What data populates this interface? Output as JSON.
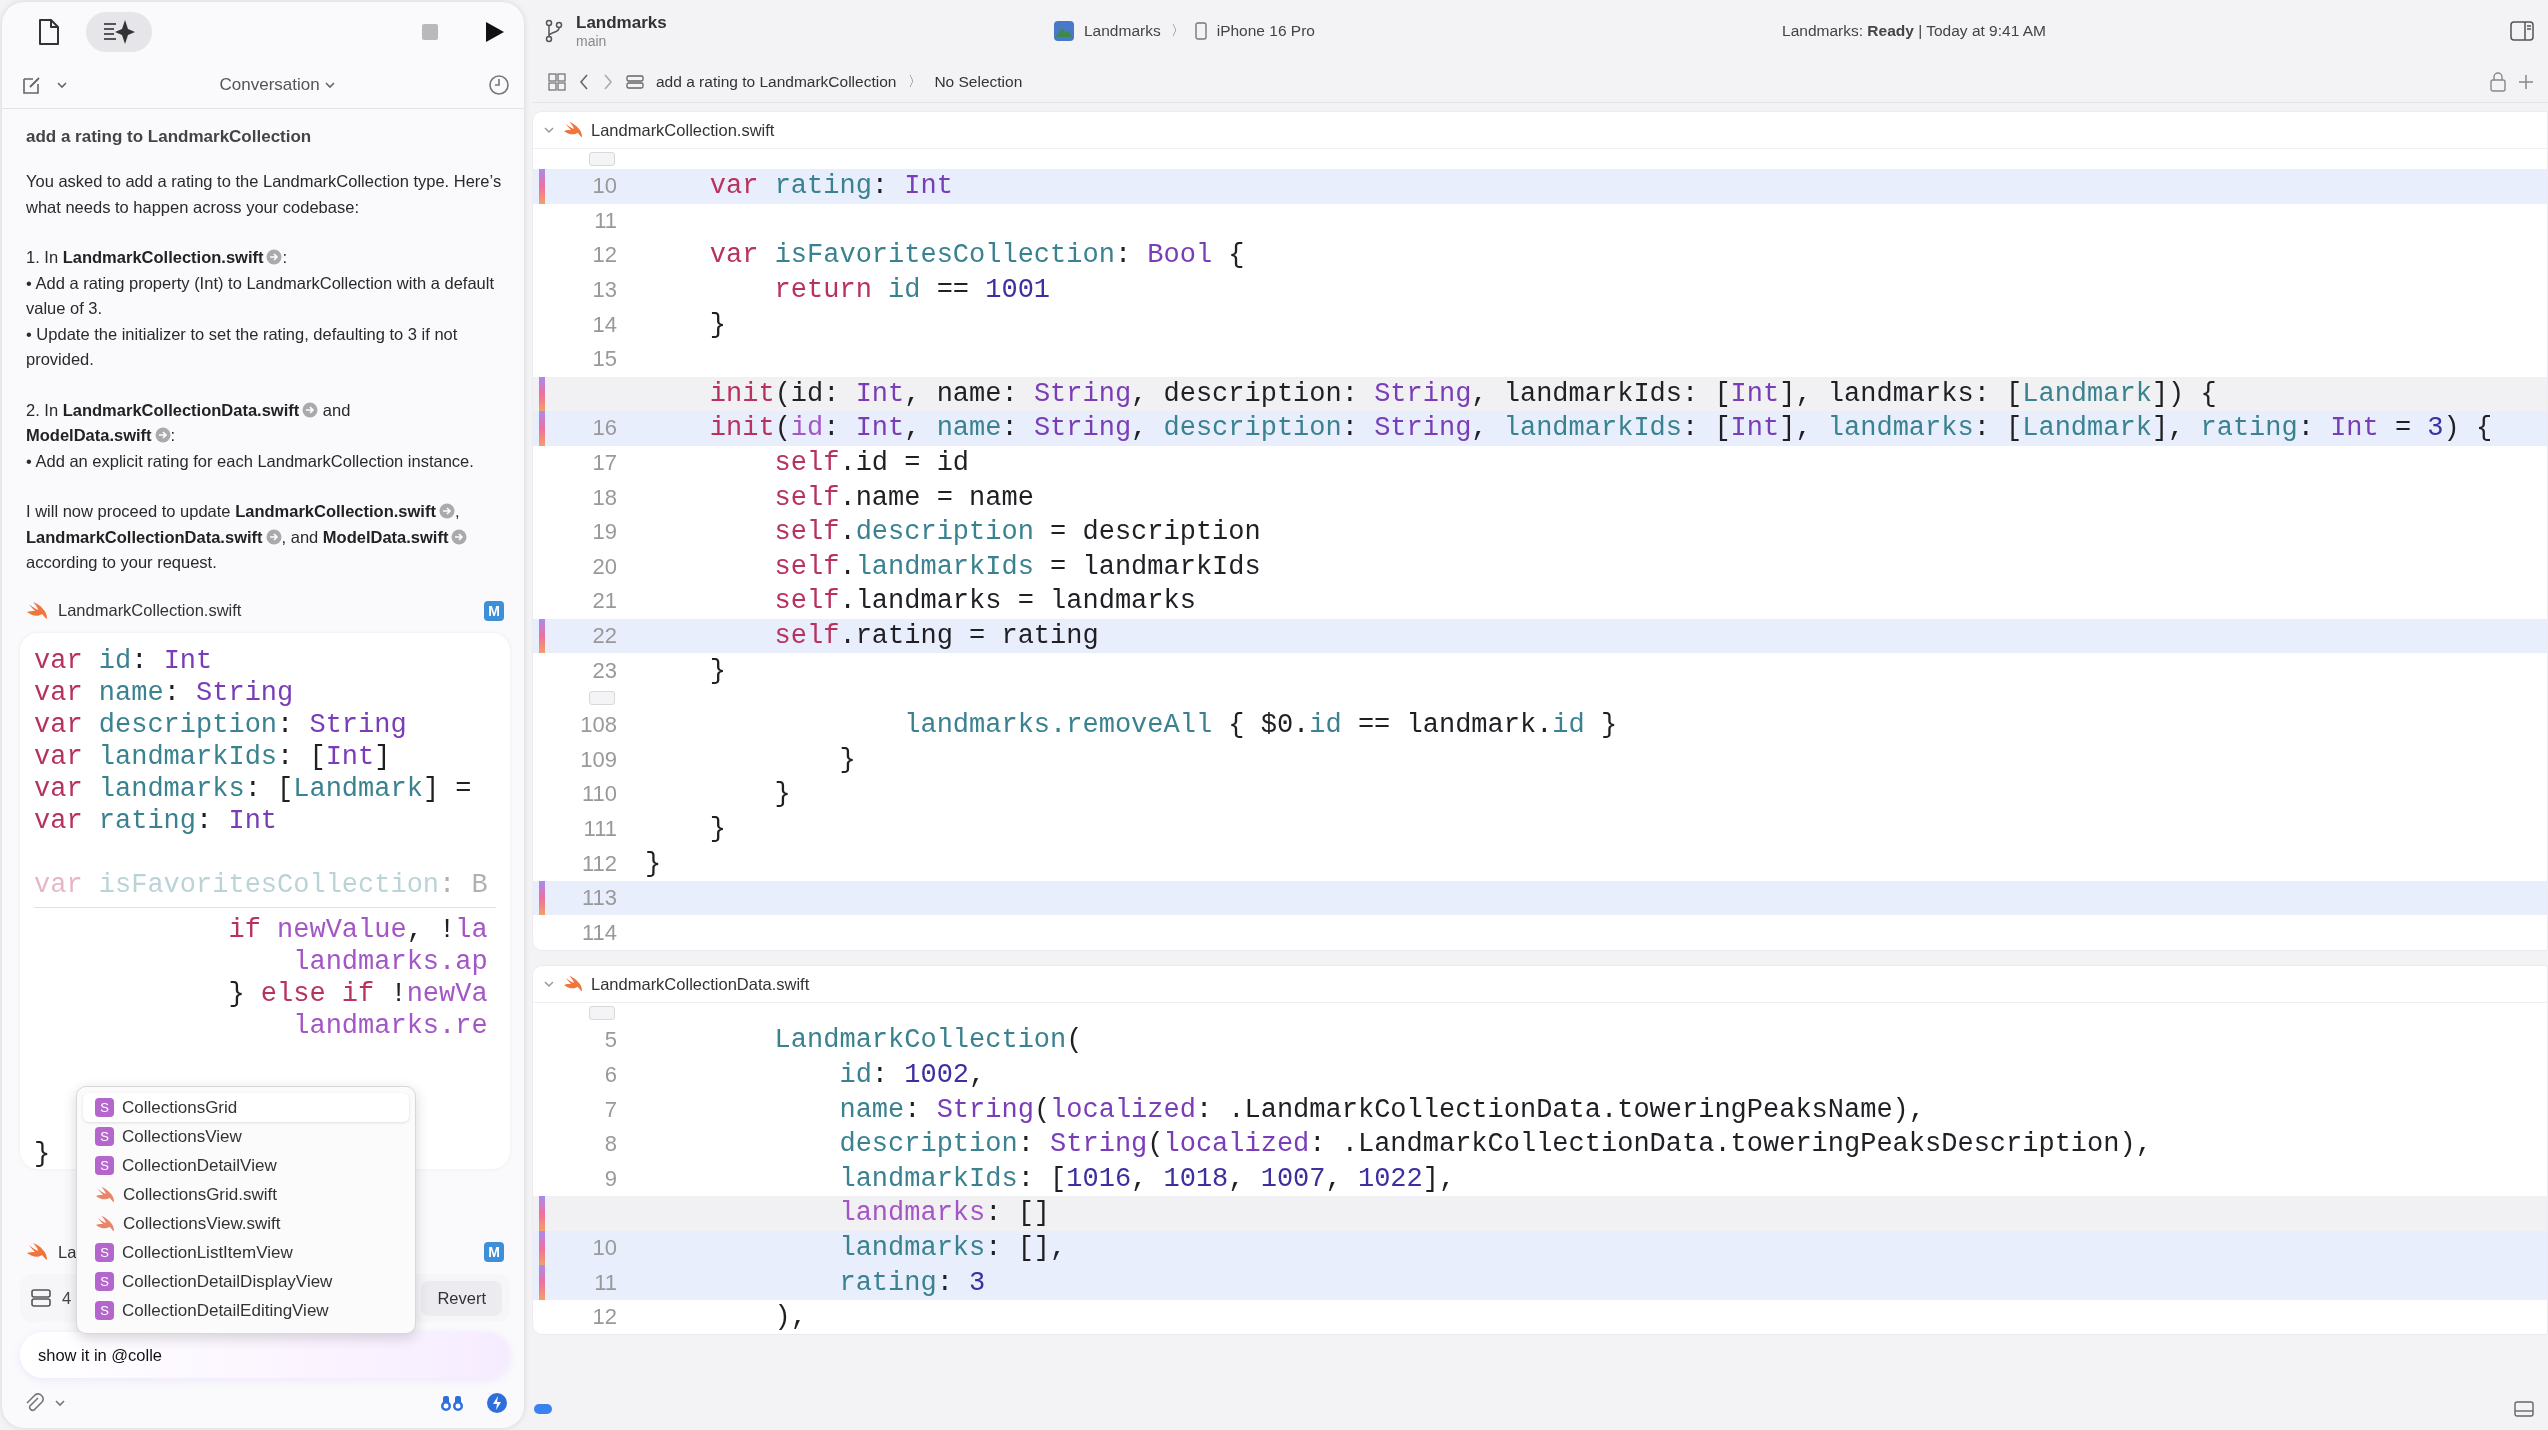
{
  "navigator_tabs": [
    {
      "kind": "files",
      "selected": false
    },
    {
      "kind": "assistant",
      "selected": true
    }
  ],
  "project": {
    "name": "Landmarks",
    "branch": "main"
  },
  "scheme": {
    "app": "Landmarks",
    "separator": "〉",
    "device": "iPhone 16 Pro"
  },
  "status": "Landmarks: **Ready** | Today at 9:41 AM",
  "breadcrumb": {
    "items": [
      "add a rating to LandmarkCollection",
      "No Selection"
    ],
    "separator": "〉"
  },
  "conversation": {
    "title": "Conversation",
    "message": {
      "title": "add a rating to LandmarkCollection",
      "paragraphs": [
        {
          "lines": [
            [
              {
                "text": "You asked to add a rating to the LandmarkCollection type. Here’s what needs to happen across your codebase:"
              }
            ]
          ]
        },
        {
          "lines": [
            [
              {
                "text": "1. In "
              },
              {
                "file": "LandmarkCollection.swift"
              },
              {
                "text": ":"
              }
            ],
            [
              {
                "text": "• Add a rating property (Int) to LandmarkCollection with a default value of 3."
              }
            ],
            [
              {
                "text": "• Update the initializer to set the rating, defaulting to 3 if not provided."
              }
            ]
          ]
        },
        {
          "lines": [
            [
              {
                "text": "2. In "
              },
              {
                "file": "LandmarkCollectionData.swift"
              },
              {
                "text": " and "
              },
              {
                "file": "ModelData.swift"
              },
              {
                "text": ":"
              }
            ],
            [
              {
                "text": "• Add an explicit rating for each LandmarkCollection instance."
              }
            ]
          ]
        },
        {
          "lines": [
            [
              {
                "text": "I will now proceed to update "
              },
              {
                "file": "LandmarkCollection.swift"
              },
              {
                "text": ", "
              },
              {
                "file": "LandmarkCollectionData.swift"
              },
              {
                "text": ", and "
              },
              {
                "file": "ModelData.swift"
              },
              {
                "text": " according to your request."
              }
            ]
          ]
        }
      ]
    },
    "files": [
      {
        "name": "LandmarkCollection.swift",
        "status": "M"
      },
      {
        "name": "La",
        "status": "M"
      }
    ],
    "snippet": [
      {
        "kind": "code",
        "faded": false,
        "tokens": [
          {
            "kind": "keyword",
            "text": "var "
          },
          {
            "kind": "property",
            "text": "id"
          },
          {
            "kind": "plain",
            "text": ": "
          },
          {
            "kind": "type",
            "text": "Int"
          }
        ]
      },
      {
        "kind": "code",
        "faded": false,
        "tokens": [
          {
            "kind": "keyword",
            "text": "var "
          },
          {
            "kind": "property",
            "text": "name"
          },
          {
            "kind": "plain",
            "text": ": "
          },
          {
            "kind": "type",
            "text": "String"
          }
        ]
      },
      {
        "kind": "code",
        "faded": false,
        "tokens": [
          {
            "kind": "keyword",
            "text": "var "
          },
          {
            "kind": "property",
            "text": "description"
          },
          {
            "kind": "plain",
            "text": ": "
          },
          {
            "kind": "type",
            "text": "String"
          }
        ]
      },
      {
        "kind": "code",
        "faded": false,
        "tokens": [
          {
            "kind": "keyword",
            "text": "var "
          },
          {
            "kind": "property",
            "text": "landmarkIds"
          },
          {
            "kind": "plain",
            "text": ": ["
          },
          {
            "kind": "type",
            "text": "Int"
          },
          {
            "kind": "plain",
            "text": "]"
          }
        ]
      },
      {
        "kind": "code",
        "faded": false,
        "tokens": [
          {
            "kind": "keyword",
            "text": "var "
          },
          {
            "kind": "property",
            "text": "landmarks"
          },
          {
            "kind": "plain",
            "text": ": ["
          },
          {
            "kind": "property",
            "text": "Landmark"
          },
          {
            "kind": "plain",
            "text": "] ="
          }
        ]
      },
      {
        "kind": "code",
        "faded": false,
        "tokens": [
          {
            "kind": "keyword",
            "text": "var "
          },
          {
            "kind": "property",
            "text": "rating"
          },
          {
            "kind": "plain",
            "text": ": "
          },
          {
            "kind": "type",
            "text": "Int"
          }
        ]
      },
      {
        "kind": "blank"
      },
      {
        "kind": "code",
        "faded": true,
        "tokens": [
          {
            "kind": "keyword",
            "text": "var "
          },
          {
            "kind": "property",
            "text": "isFavoritesCollection"
          },
          {
            "kind": "plain",
            "text": ": B"
          }
        ]
      },
      {
        "kind": "fold"
      },
      {
        "kind": "code",
        "faded": false,
        "tokens": [
          {
            "kind": "keyword",
            "text": "            if "
          },
          {
            "kind": "member",
            "text": "newValue"
          },
          {
            "kind": "plain",
            "text": ", !"
          },
          {
            "kind": "member",
            "text": "la"
          }
        ]
      },
      {
        "kind": "code",
        "faded": false,
        "tokens": [
          {
            "kind": "member",
            "text": "                landmarks.ap"
          }
        ]
      },
      {
        "kind": "code",
        "faded": false,
        "tokens": [
          {
            "kind": "plain",
            "text": "            }"
          },
          {
            "kind": "keyword",
            "text": " else if"
          },
          {
            "kind": "plain",
            "text": " !"
          },
          {
            "kind": "member",
            "text": "newVa"
          }
        ]
      },
      {
        "kind": "code",
        "faded": false,
        "tokens": [
          {
            "kind": "member",
            "text": "                landmarks.re"
          }
        ]
      },
      {
        "kind": "blank"
      },
      {
        "kind": "blank"
      },
      {
        "kind": "blank"
      },
      {
        "kind": "code",
        "faded": false,
        "tokens": [
          {
            "kind": "plain",
            "text": "}"
          }
        ]
      }
    ],
    "changes": {
      "count": "4",
      "button": "Revert"
    },
    "completions": [
      {
        "kind": "struct",
        "badge": "S",
        "label": "CollectionsGrid",
        "selected": true
      },
      {
        "kind": "struct",
        "badge": "S",
        "label": "CollectionsView",
        "selected": false
      },
      {
        "kind": "struct",
        "badge": "S",
        "label": "CollectionDetailView",
        "selected": false
      },
      {
        "kind": "file",
        "label": "CollectionsGrid.swift",
        "selected": false
      },
      {
        "kind": "file",
        "label": "CollectionsView.swift",
        "selected": false
      },
      {
        "kind": "struct",
        "badge": "S",
        "label": "CollectionListItemView",
        "selected": false
      },
      {
        "kind": "struct",
        "badge": "S",
        "label": "CollectionDetailDisplayView",
        "selected": false
      },
      {
        "kind": "struct",
        "badge": "S",
        "label": "CollectionDetailEditingView",
        "selected": false
      }
    ],
    "input": {
      "value": "show it in @colle"
    }
  },
  "editor": {
    "sections": [
      {
        "file": "LandmarkCollection.swift",
        "lines": [
          {
            "kind": "fold"
          },
          {
            "kind": "code",
            "number": "10",
            "added": true,
            "removed": false,
            "tokens": [
              {
                "kind": "keyword",
                "text": "    var "
              },
              {
                "kind": "property",
                "text": "rating"
              },
              {
                "kind": "plain",
                "text": ": "
              },
              {
                "kind": "type",
                "text": "Int"
              }
            ]
          },
          {
            "kind": "code",
            "number": "11",
            "added": false,
            "removed": false
          },
          {
            "kind": "code",
            "number": "12",
            "added": false,
            "removed": false,
            "tokens": [
              {
                "kind": "keyword",
                "text": "    var "
              },
              {
                "kind": "property",
                "text": "isFavoritesCollection"
              },
              {
                "kind": "plain",
                "text": ": "
              },
              {
                "kind": "type",
                "text": "Bool"
              },
              {
                "kind": "plain",
                "text": " {"
              }
            ]
          },
          {
            "kind": "code",
            "number": "13",
            "added": false,
            "removed": false,
            "tokens": [
              {
                "kind": "keyword",
                "text": "        return "
              },
              {
                "kind": "property",
                "text": "id"
              },
              {
                "kind": "plain",
                "text": " == "
              },
              {
                "kind": "number",
                "text": "1001"
              }
            ]
          },
          {
            "kind": "code",
            "number": "14",
            "added": false,
            "removed": false,
            "tokens": [
              {
                "kind": "plain",
                "text": "    }"
              }
            ]
          },
          {
            "kind": "code",
            "number": "15",
            "added": false,
            "removed": false
          },
          {
            "kind": "code",
            "added": false,
            "removed": true,
            "tokens": [
              {
                "kind": "keyword",
                "text": "    init"
              },
              {
                "kind": "plain",
                "text": "(id: "
              },
              {
                "kind": "type",
                "text": "Int"
              },
              {
                "kind": "plain",
                "text": ", name: "
              },
              {
                "kind": "type",
                "text": "String"
              },
              {
                "kind": "plain",
                "text": ", description: "
              },
              {
                "kind": "type",
                "text": "String"
              },
              {
                "kind": "plain",
                "text": ", landmarkIds: ["
              },
              {
                "kind": "type",
                "text": "Int"
              },
              {
                "kind": "plain",
                "text": "], landmarks: ["
              },
              {
                "kind": "property",
                "text": "Landmark"
              },
              {
                "kind": "plain",
                "text": "]) {"
              }
            ]
          },
          {
            "kind": "code",
            "number": "16",
            "added": true,
            "removed": false,
            "tokens": [
              {
                "kind": "keyword",
                "text": "    init"
              },
              {
                "kind": "plain",
                "text": "("
              },
              {
                "kind": "member",
                "text": "id"
              },
              {
                "kind": "plain",
                "text": ": "
              },
              {
                "kind": "type",
                "text": "Int"
              },
              {
                "kind": "plain",
                "text": ", "
              },
              {
                "kind": "property",
                "text": "name"
              },
              {
                "kind": "plain",
                "text": ": "
              },
              {
                "kind": "type",
                "text": "String"
              },
              {
                "kind": "plain",
                "text": ", "
              },
              {
                "kind": "property",
                "text": "description"
              },
              {
                "kind": "plain",
                "text": ": "
              },
              {
                "kind": "type",
                "text": "String"
              },
              {
                "kind": "plain",
                "text": ", "
              },
              {
                "kind": "property",
                "text": "landmarkIds"
              },
              {
                "kind": "plain",
                "text": ": ["
              },
              {
                "kind": "type",
                "text": "Int"
              },
              {
                "kind": "plain",
                "text": "], "
              },
              {
                "kind": "property",
                "text": "landmarks"
              },
              {
                "kind": "plain",
                "text": ": ["
              },
              {
                "kind": "property",
                "text": "Landmark"
              },
              {
                "kind": "plain",
                "text": "], "
              },
              {
                "kind": "property",
                "text": "rating"
              },
              {
                "kind": "plain",
                "text": ": "
              },
              {
                "kind": "type",
                "text": "Int"
              },
              {
                "kind": "plain",
                "text": " = "
              },
              {
                "kind": "number",
                "text": "3"
              },
              {
                "kind": "plain",
                "text": ") {"
              }
            ]
          },
          {
            "kind": "code",
            "number": "17",
            "added": false,
            "removed": false,
            "tokens": [
              {
                "kind": "keyword",
                "text": "        self"
              },
              {
                "kind": "plain",
                "text": ".id = id"
              }
            ]
          },
          {
            "kind": "code",
            "number": "18",
            "added": false,
            "removed": false,
            "tokens": [
              {
                "kind": "keyword",
                "text": "        self"
              },
              {
                "kind": "plain",
                "text": ".name = name"
              }
            ]
          },
          {
            "kind": "code",
            "number": "19",
            "added": false,
            "removed": false,
            "tokens": [
              {
                "kind": "keyword",
                "text": "        self"
              },
              {
                "kind": "plain",
                "text": "."
              },
              {
                "kind": "property",
                "text": "description"
              },
              {
                "kind": "plain",
                "text": " = description"
              }
            ]
          },
          {
            "kind": "code",
            "number": "20",
            "added": false,
            "removed": false,
            "tokens": [
              {
                "kind": "keyword",
                "text": "        self"
              },
              {
                "kind": "plain",
                "text": "."
              },
              {
                "kind": "property",
                "text": "landmarkIds"
              },
              {
                "kind": "plain",
                "text": " = landmarkIds"
              }
            ]
          },
          {
            "kind": "code",
            "number": "21",
            "added": false,
            "removed": false,
            "tokens": [
              {
                "kind": "keyword",
                "text": "        self"
              },
              {
                "kind": "plain",
                "text": ".landmarks = landmarks"
              }
            ]
          },
          {
            "kind": "code",
            "number": "22",
            "added": true,
            "removed": false,
            "tokens": [
              {
                "kind": "keyword",
                "text": "        self"
              },
              {
                "kind": "plain",
                "text": ".rating = rating"
              }
            ]
          },
          {
            "kind": "code",
            "number": "23",
            "added": false,
            "removed": false,
            "tokens": [
              {
                "kind": "plain",
                "text": "    }"
              }
            ]
          },
          {
            "kind": "fold"
          },
          {
            "kind": "code",
            "number": "108",
            "added": false,
            "removed": false,
            "tokens": [
              {
                "kind": "property",
                "text": "                landmarks.removeAll"
              },
              {
                "kind": "plain",
                "text": " { $0."
              },
              {
                "kind": "property",
                "text": "id"
              },
              {
                "kind": "plain",
                "text": " == landmark."
              },
              {
                "kind": "property",
                "text": "id"
              },
              {
                "kind": "plain",
                "text": " }"
              }
            ]
          },
          {
            "kind": "code",
            "number": "109",
            "added": false,
            "removed": false,
            "tokens": [
              {
                "kind": "plain",
                "text": "            }"
              }
            ]
          },
          {
            "kind": "code",
            "number": "110",
            "added": false,
            "removed": false,
            "tokens": [
              {
                "kind": "plain",
                "text": "        }"
              }
            ]
          },
          {
            "kind": "code",
            "number": "111",
            "added": false,
            "removed": false,
            "tokens": [
              {
                "kind": "plain",
                "text": "    }"
              }
            ]
          },
          {
            "kind": "code",
            "number": "112",
            "added": false,
            "removed": false,
            "tokens": [
              {
                "kind": "plain",
                "text": "}"
              }
            ]
          },
          {
            "kind": "code",
            "number": "113",
            "added": true,
            "removed": false
          },
          {
            "kind": "code",
            "number": "114",
            "added": false,
            "removed": false
          }
        ]
      },
      {
        "file": "LandmarkCollectionData.swift",
        "lines": [
          {
            "kind": "fold"
          },
          {
            "kind": "code",
            "number": "5",
            "added": false,
            "removed": false,
            "tokens": [
              {
                "kind": "property",
                "text": "        LandmarkCollection"
              },
              {
                "kind": "plain",
                "text": "("
              }
            ]
          },
          {
            "kind": "code",
            "number": "6",
            "added": false,
            "removed": false,
            "tokens": [
              {
                "kind": "property",
                "text": "            id"
              },
              {
                "kind": "plain",
                "text": ": "
              },
              {
                "kind": "number",
                "text": "1002"
              },
              {
                "kind": "plain",
                "text": ","
              }
            ]
          },
          {
            "kind": "code",
            "number": "7",
            "added": false,
            "removed": false,
            "tokens": [
              {
                "kind": "property",
                "text": "            name"
              },
              {
                "kind": "plain",
                "text": ": "
              },
              {
                "kind": "type",
                "text": "String"
              },
              {
                "kind": "plain",
                "text": "("
              },
              {
                "kind": "type",
                "text": "localized"
              },
              {
                "kind": "plain",
                "text": ": .LandmarkCollectionData.toweringPeaksName),"
              }
            ]
          },
          {
            "kind": "code",
            "number": "8",
            "added": false,
            "removed": false,
            "tokens": [
              {
                "kind": "property",
                "text": "            description"
              },
              {
                "kind": "plain",
                "text": ": "
              },
              {
                "kind": "type",
                "text": "String"
              },
              {
                "kind": "plain",
                "text": "("
              },
              {
                "kind": "type",
                "text": "localized"
              },
              {
                "kind": "plain",
                "text": ": .LandmarkCollectionData.toweringPeaksDescription),"
              }
            ]
          },
          {
            "kind": "code",
            "number": "9",
            "added": false,
            "removed": false,
            "tokens": [
              {
                "kind": "property",
                "text": "            landmarkIds"
              },
              {
                "kind": "plain",
                "text": ": ["
              },
              {
                "kind": "number",
                "text": "1016"
              },
              {
                "kind": "plain",
                "text": ", "
              },
              {
                "kind": "number",
                "text": "1018"
              },
              {
                "kind": "plain",
                "text": ", "
              },
              {
                "kind": "number",
                "text": "1007"
              },
              {
                "kind": "plain",
                "text": ", "
              },
              {
                "kind": "number",
                "text": "1022"
              },
              {
                "kind": "plain",
                "text": "],"
              }
            ]
          },
          {
            "kind": "code",
            "added": false,
            "removed": true,
            "tokens": [
              {
                "kind": "member",
                "text": "            landmarks"
              },
              {
                "kind": "plain",
                "text": ": []"
              }
            ]
          },
          {
            "kind": "code",
            "number": "10",
            "added": true,
            "removed": false,
            "tokens": [
              {
                "kind": "property",
                "text": "            landmarks"
              },
              {
                "kind": "plain",
                "text": ": [],"
              }
            ]
          },
          {
            "kind": "code",
            "number": "11",
            "added": true,
            "removed": false,
            "tokens": [
              {
                "kind": "property",
                "text": "            rating"
              },
              {
                "kind": "plain",
                "text": ": "
              },
              {
                "kind": "number",
                "text": "3"
              }
            ]
          },
          {
            "kind": "code",
            "number": "12",
            "added": false,
            "removed": false,
            "tokens": [
              {
                "kind": "plain",
                "text": "        ),"
              }
            ]
          }
        ]
      }
    ]
  }
}
